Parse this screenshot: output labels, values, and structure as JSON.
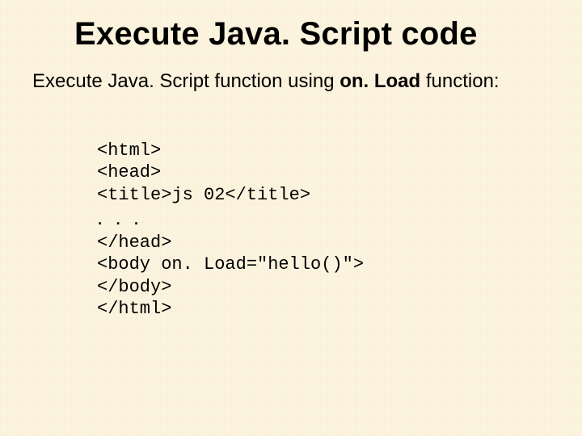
{
  "title": "Execute Java. Script code",
  "subtitle_prefix": "Execute Java. Script function using ",
  "subtitle_bold": "on. Load",
  "subtitle_suffix": " function:",
  "code": {
    "l1": "<html>",
    "l2": "<head>",
    "l3": "<title>js 02</title>",
    "ellipsis": ". . .",
    "l4": "</head>",
    "l5": "<body on. Load=\"hello()\">",
    "l6": "</body>",
    "l7": "</html>"
  }
}
